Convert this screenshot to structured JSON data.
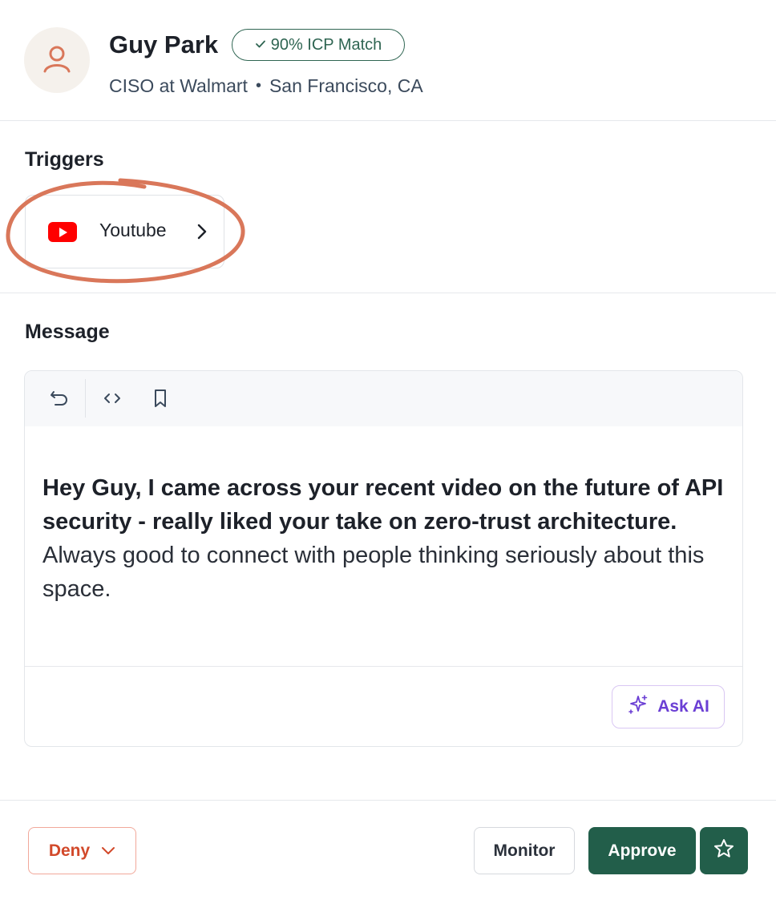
{
  "profile": {
    "name": "Guy Park",
    "icp_badge": "90% ICP Match",
    "role": "CISO at Walmart",
    "separator": "•",
    "location": "San Francisco, CA",
    "avatar_icon": "user-icon"
  },
  "triggers": {
    "title": "Triggers",
    "items": [
      {
        "label": "Youtube",
        "icon": "youtube-icon"
      }
    ]
  },
  "message": {
    "title": "Message",
    "toolbar": [
      "undo-icon",
      "code-icon",
      "bookmark-icon"
    ],
    "body_bold": "Hey Guy, I came across your recent video on the future of API security - really liked your take on zero-trust architecture.",
    "body_regular": " Always good to connect with people thinking seriously about this space.",
    "ask_ai_label": "Ask AI"
  },
  "actions": {
    "deny_label": "Deny",
    "monitor_label": "Monitor",
    "approve_label": "Approve"
  },
  "colors": {
    "brand_green": "#225e4a",
    "deny_red": "#d2492a",
    "ai_purple": "#6b3fd4",
    "annotation": "#d9775a"
  }
}
